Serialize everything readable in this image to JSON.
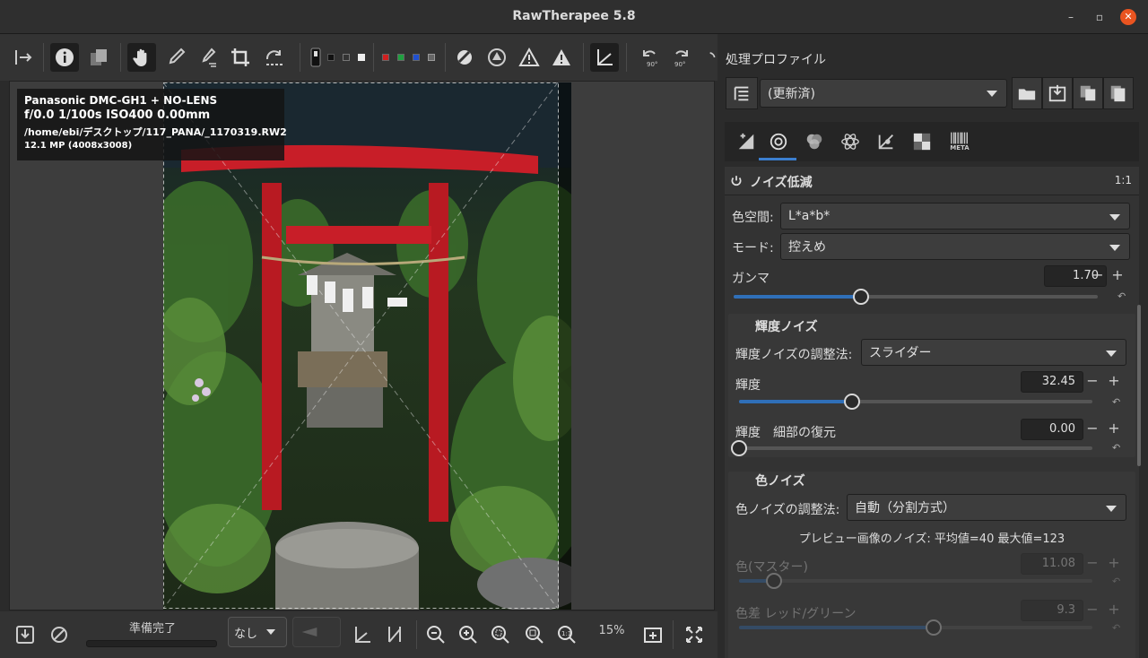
{
  "window": {
    "title": "RawTherapee 5.8",
    "minimize": "–",
    "maximize": "▫",
    "close": "✕"
  },
  "info": {
    "camera": "Panasonic DMC-GH1 + NO-LENS",
    "exposure": "f/0.0  1/100s  ISO400  0.00mm",
    "path": "/home/ebi/デスクトップ/117_PANA/_1170319.RW2",
    "size": "12.1 MP (4008x3008)"
  },
  "bottom": {
    "status": "準備完了",
    "preset": "なし",
    "zoom": "15%",
    "progress": 0
  },
  "profile": {
    "label": "処理プロファイル",
    "value": "(更新済)"
  },
  "tabs": [
    "exposure-tab",
    "detail-tab",
    "color-tab",
    "advanced-tab",
    "transform-tab",
    "raw-tab",
    "meta-tab"
  ],
  "tab_meta_label": "META",
  "noise": {
    "header": "ノイズ低減",
    "header_right": "1:1",
    "colorspace_label": "色空間:",
    "colorspace_value": "L*a*b*",
    "mode_label": "モード:",
    "mode_value": "控えめ",
    "gamma_label": "ガンマ",
    "gamma_value": "1.70",
    "gamma_level": 0.35,
    "luma_section": "輝度ノイズ",
    "luma_method_label": "輝度ノイズの調整法:",
    "luma_method_value": "スライダー",
    "luminance_label": "輝度",
    "luminance_value": "32.45",
    "luminance_level": 0.32,
    "detail_label": "輝度　細部の復元",
    "detail_value": "0.00",
    "detail_level": 0.0,
    "chroma_section": "色ノイズ",
    "chroma_method_label": "色ノイズの調整法:",
    "chroma_method_value": "自動（分割方式）",
    "preview_noise": "プレビュー画像のノイズ: 平均値=40  最大値=123",
    "chroma_master_label": "色(マスター)",
    "chroma_master_value": "11.08",
    "chroma_master_level": 0.1,
    "redgreen_label": "色差 レッド/グリーン",
    "redgreen_value": "9.3",
    "redgreen_level": 0.55
  },
  "colors": {
    "accent": "#3c7fd0",
    "torii": "#c81e28"
  }
}
